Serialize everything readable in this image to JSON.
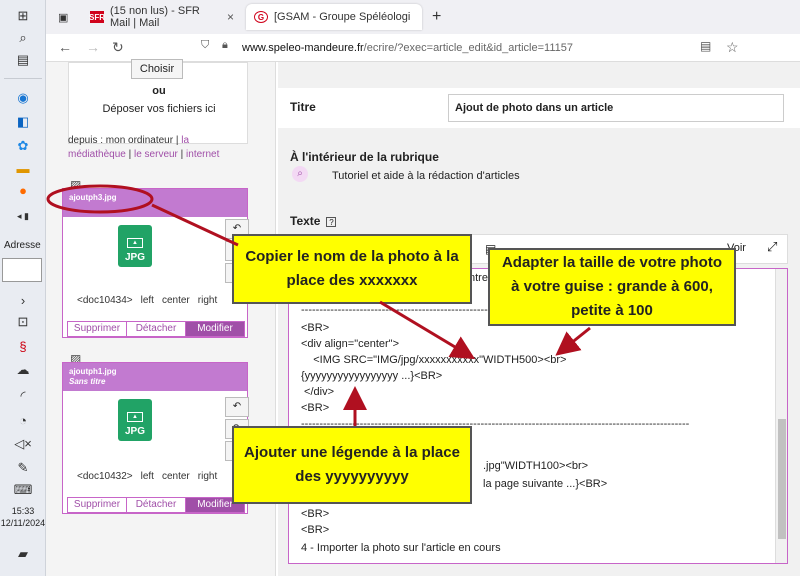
{
  "taskbar": {
    "address_label": "Adresse",
    "clock_time": "15:33",
    "clock_date": "12/11/2024"
  },
  "tabs": [
    {
      "label": "(15 non lus) - SFR Mail | Mail",
      "favicon": "SFR"
    },
    {
      "label": "[GSAM - Groupe Spéléologique",
      "favicon": "G"
    }
  ],
  "url": {
    "host": "www.speleo-mandeure.fr",
    "path": "/ecrire/?exec=article_edit&id_article=11157"
  },
  "upload": {
    "choose_label": "Choisir",
    "or_label": "ou",
    "drop_label": "Déposer vos fichiers ici",
    "from_label": "depuis : mon ordinateur |",
    "from_links": [
      "la médiathèque",
      "le serveur",
      "internet"
    ]
  },
  "documents": [
    {
      "filename": "ajoutph3.jpg",
      "subtitle": "",
      "type_label": "JPG",
      "doc_id": "<doc10434>",
      "align": [
        "left",
        "center",
        "right"
      ],
      "actions": [
        "Supprimer",
        "Détacher",
        "Modifier"
      ]
    },
    {
      "filename": "ajoutph1.jpg",
      "subtitle": "Sans titre",
      "type_label": "JPG",
      "doc_id": "<doc10432>",
      "align": [
        "left",
        "center",
        "right"
      ],
      "actions": [
        "Supprimer",
        "Détacher",
        "Modifier"
      ]
    }
  ],
  "form": {
    "title_label": "Titre",
    "title_value": "Ajout de photo dans un article",
    "rubrique_label": "À l'intérieur de la rubrique",
    "rubrique_value": "Tutoriel et aide à la rédaction d'articles",
    "text_label": "Texte",
    "help_icon": "?",
    "toolbar_right": "Voir"
  },
  "editor_lines": [
    "ntre",
    "----------------------------------------------------------------------------------------------------------",
    "<BR>",
    "<div align=\"center\">",
    "    <IMG SRC=\"IMG/jpg/xxxxxxxxxxx\"WIDTH500><br>",
    "{yyyyyyyyyyyyyyyyy ...}<BR>",
    " </div>",
    "<BR>",
    "----------------------------------------------------------------------------------------------------------",
    ".jpg\"WIDTH100><br>",
    "la page suivante ...}<BR>",
    "<BR>",
    "<BR>",
    "4 - Importer la photo sur l'article en cours"
  ],
  "callouts": {
    "copy": "Copier le nom de la photo à la place des xxxxxxx",
    "size": "Adapter la taille de votre photo à votre guise : grande à 600, petite à 100",
    "legend": "Ajouter une légende à la place des yyyyyyyyyy"
  },
  "colors": {
    "accent": "#c765c8",
    "callout_bg": "#ffff00",
    "arrow": "#b01020",
    "jpg_green": "#21a366"
  }
}
